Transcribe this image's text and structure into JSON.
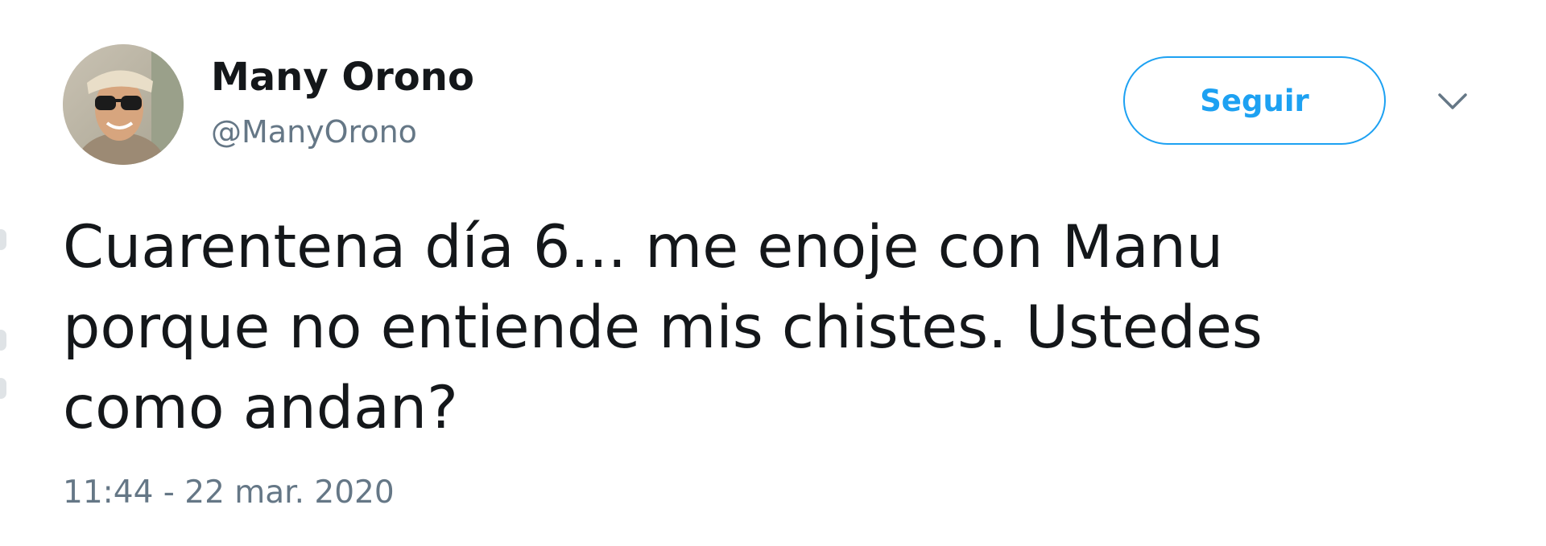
{
  "author": {
    "name": "Many Orono",
    "handle": "@ManyOrono"
  },
  "follow_button": {
    "label": "Seguir"
  },
  "tweet": {
    "lines": [
      "Cuarentena día 6... me enoje con Manu",
      "porque no entiende mis chistes. Ustedes",
      "como andan?"
    ],
    "timestamp": "11:44 - 22 mar. 2020"
  },
  "icons": {
    "menu": "chevron-down-icon",
    "avatar": "profile-photo"
  },
  "colors": {
    "accent": "#1da1f2",
    "text_primary": "#14171a",
    "text_secondary": "#657786",
    "background": "#ffffff"
  }
}
